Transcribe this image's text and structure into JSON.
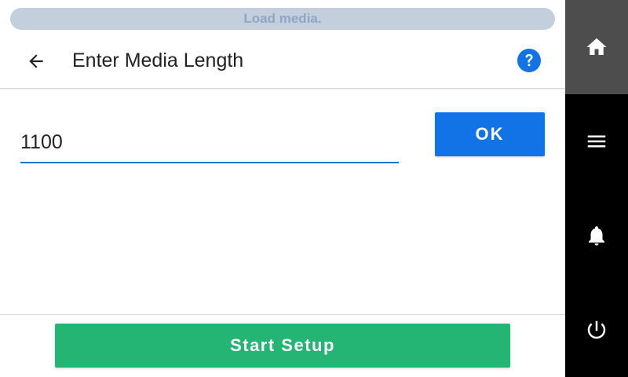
{
  "status_banner": {
    "text": "Load media."
  },
  "header": {
    "title": "Enter Media Length",
    "back_icon": "arrow-left-icon",
    "help_icon": "question-circle-icon"
  },
  "form": {
    "media_length_value": "1100",
    "ok_label": "OK"
  },
  "footer": {
    "start_setup_label": "Start Setup"
  },
  "sidebar": {
    "items": [
      {
        "icon": "home-icon",
        "active": true
      },
      {
        "icon": "menu-icon",
        "active": false
      },
      {
        "icon": "bell-icon",
        "active": false
      },
      {
        "icon": "power-icon",
        "active": false
      }
    ]
  },
  "colors": {
    "accent_blue": "#1173e6",
    "start_green": "#24b574",
    "sidebar_bg": "#000000",
    "sidebar_active": "#4d4d4d",
    "status_pill_bg": "#c3cfdd"
  }
}
